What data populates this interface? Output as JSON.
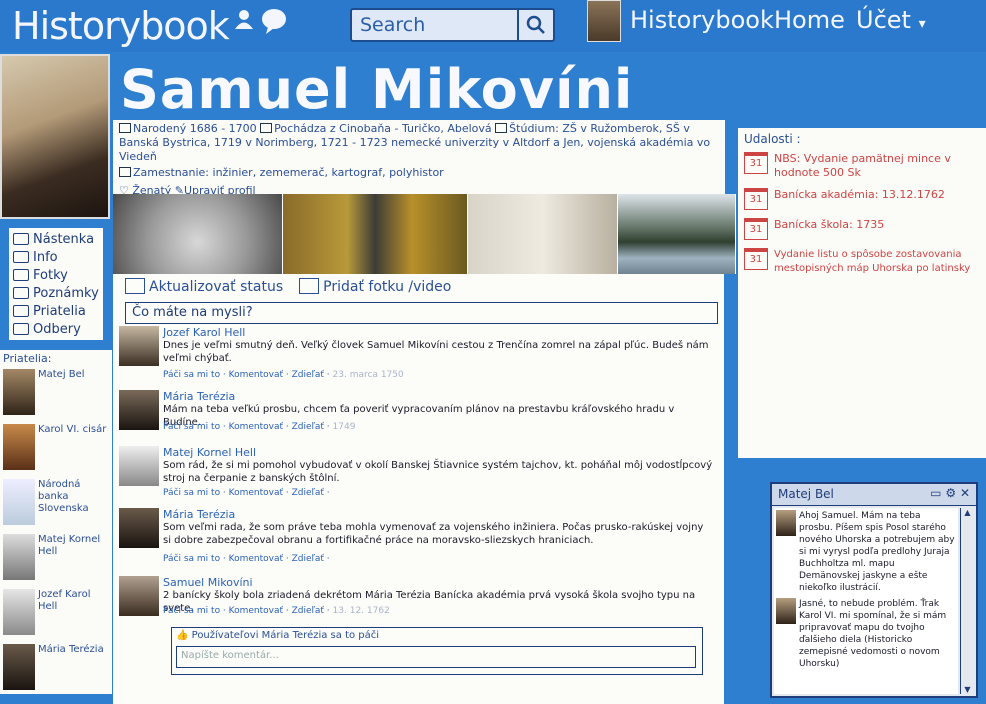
{
  "nav": {
    "logo": "Historybook",
    "search_placeholder": "Search",
    "user_link": "Historybook",
    "home": "Home",
    "account": "Účet"
  },
  "profile": {
    "name": "Samuel Mikovíni",
    "born": "Narodený 1686 - 1700",
    "origin": "Pochádza z Cinobaňa - Turičko, Abelová",
    "study": "Štúdium: ZŠ v Ružomberok, SŠ v Banská Bystrica, 1719 v Norimberg, 1721 - 1723 nemecké univerzity v Altdorf a Jen, vojenská akadémia vo Viedeň",
    "job": "Zamestnanie: inžinier, zememerač, kartograf, polyhistor",
    "married": "Ženatý",
    "edit": "Upraviť profil"
  },
  "leftnav": [
    "Nástenka",
    "Info",
    "Fotky",
    "Poznámky",
    "Priatelia",
    "Odbery"
  ],
  "friends": {
    "title": "Priatelia:",
    "items": [
      "Matej Bel",
      "Karol VI. cisár",
      "Národná banka Slovenska",
      "Matej Kornel Hell",
      "Jozef Karol Hell",
      "Mária Terézia"
    ]
  },
  "feed": {
    "update_status": "Aktualizovať status",
    "add_photo": "Pridať fotku /video",
    "whats_on_mind": "Čo máte na mysli?",
    "posts": [
      {
        "author": "Jozef Karol Hell",
        "text": "Dnes je veľmi smutný deň. Veľký človek Samuel Mikovíni cestou z Trenčína zomrel na zápal pľúc. Budeš nám veľmi chýbať.",
        "actions": "Páči sa mi to · Komentovať · Zdieľať ·",
        "date": "23. marca 1750"
      },
      {
        "author": "Mária Terézia",
        "text": "Mám na teba veľkú prosbu, chcem ťa poveriť vypracovaním plánov na prestavbu kráľovského hradu v Budíne.",
        "actions": "Páči sa mi to · Komentovať · Zdieľať ·",
        "date": "1749"
      },
      {
        "author": "Matej Kornel Hell",
        "text": "Som rád, že si mi pomohol vybudovať v okolí Banskej Štiavnice systém tajchov, kt. poháňal môj vodostĺpcový stroj na čerpanie z banských štôlní.",
        "actions": "Páči sa mi to · Komentovať · Zdieľať ·",
        "date": ""
      },
      {
        "author": "Mária Terézia",
        "text": "Som veľmi rada, že som práve teba mohla vymenovať za vojenského inžiniera. Počas prusko-rakúskej vojny si dobre zabezpečoval obranu a fortifikačné práce na moravsko-sliezskych hraniciach.",
        "actions": "Páči sa mi to · Komentovať · Zdieľať ·",
        "date": ""
      },
      {
        "author": "Samuel Mikovíni",
        "text": "2 banícky školy bola zriadená dekrétom Mária Terézia Banícka akadémia prvá vysoká škola svojho typu na svete.",
        "actions": "Páči sa mi to · Komentovať · Zdieľať ·",
        "date": "13. 12. 1762"
      }
    ],
    "likes": "Používateľovi Mária Terézia sa to páči",
    "comment_placeholder": "Napíšte komentár..."
  },
  "events": {
    "title": "Udalosti :",
    "items": [
      {
        "day": "31",
        "text": "NBS: Vydanie pamätnej mince v hodnote 500 Sk"
      },
      {
        "day": "31",
        "text": "Banícka akadémia: 13.12.1762"
      },
      {
        "day": "31",
        "text": "Banícka škola: 1735"
      },
      {
        "day": "31",
        "text": "Vydanie listu o spôsobe zostavovania mestopisných máp Uhorska po latinsky"
      }
    ]
  },
  "chat": {
    "title": "Matej Bel",
    "messages": [
      "Ahoj Samuel. Mám na teba prosbu. Píšem spis Posol starého nového Uhorska a potrebujem aby si mi vyrysl podľa predlohy Juraja Buchholtza ml. mapu Demänovskej jaskyne a ešte niekoľko ilustrácií.",
      "Jasné, to nebude problém. Ťrak Karol VI. mi spomínal, že si mám pripravovať mapu do tvojho ďalšieho diela (Historicko zemepisné vedomosti o novom Uhorsku)"
    ]
  },
  "colors": {
    "background": "#2f7fd0",
    "accent": "#1f3d7a",
    "event_red": "#c44444"
  }
}
